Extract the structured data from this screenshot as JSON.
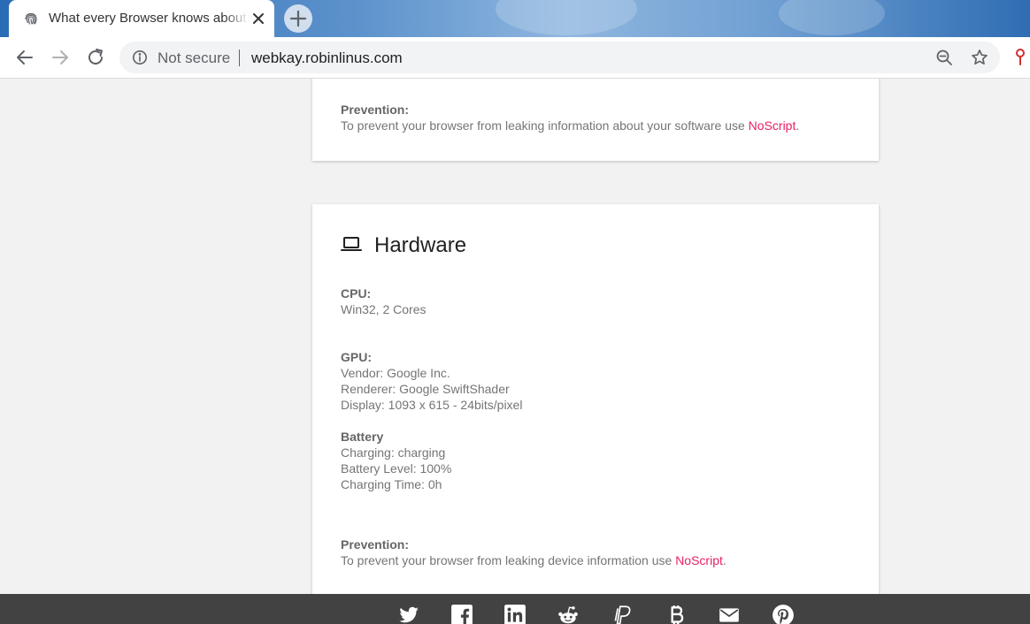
{
  "browser": {
    "tab_title": "What every Browser knows about you",
    "security_label": "Not secure",
    "url": "webkay.robinlinus.com"
  },
  "software_card": {
    "prevention_label": "Prevention:",
    "prevention_text": "To prevent your browser from leaking information about your software use ",
    "link_text": "NoScript",
    "link_suffix": "."
  },
  "hardware_card": {
    "title": "Hardware",
    "cpu_label": "CPU:",
    "cpu_value": "Win32, 2 Cores",
    "gpu_label": "GPU:",
    "gpu_vendor": "Vendor: Google Inc.",
    "gpu_renderer": "Renderer: Google SwiftShader",
    "gpu_display": "Display: 1093 x 615 - 24bits/pixel",
    "battery_label": "Battery",
    "battery_charging": "Charging: charging",
    "battery_level": "Battery Level: 100%",
    "battery_time": "Charging Time: 0h",
    "prevention_label": "Prevention:",
    "prevention_text": "To prevent your browser from leaking device information use ",
    "link_text": "NoScript",
    "link_suffix": "."
  },
  "footer": {
    "icons": [
      "twitter-icon",
      "facebook-icon",
      "linkedin-icon",
      "reddit-icon",
      "paypal-icon",
      "bitcoin-icon",
      "email-icon",
      "pinterest-icon"
    ]
  },
  "colors": {
    "link": "#e91e63",
    "footer": "#424242",
    "page_background": "#f2f2f2"
  }
}
